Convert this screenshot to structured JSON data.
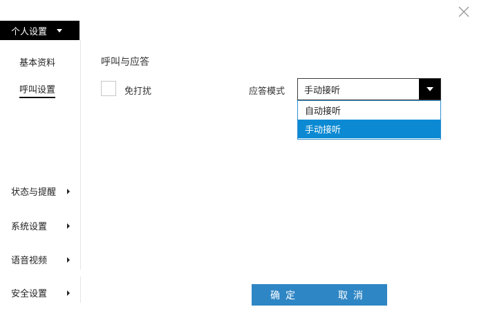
{
  "window": {
    "close_icon": "close-icon"
  },
  "sidebar": {
    "section_label": "个人设置",
    "sub_items": [
      {
        "label": "基本资料",
        "active": false
      },
      {
        "label": "呼叫设置",
        "active": true
      }
    ],
    "groups": [
      {
        "label": "状态与提醒"
      },
      {
        "label": "系统设置"
      },
      {
        "label": "语音视频"
      },
      {
        "label": "安全设置"
      }
    ]
  },
  "main": {
    "title": "呼叫与应答",
    "do_not_disturb": {
      "label": "免打扰",
      "checked": false
    },
    "answer_mode": {
      "label": "应答模式",
      "selected": "手动接听",
      "options": [
        {
          "label": "自动接听",
          "selected": false
        },
        {
          "label": "手动接听",
          "selected": true
        }
      ]
    }
  },
  "footer": {
    "ok_label": "确定",
    "cancel_label": "取消"
  },
  "colors": {
    "accent": "#0b8ad3",
    "button": "#2f86c5",
    "header_bg": "#000000"
  }
}
